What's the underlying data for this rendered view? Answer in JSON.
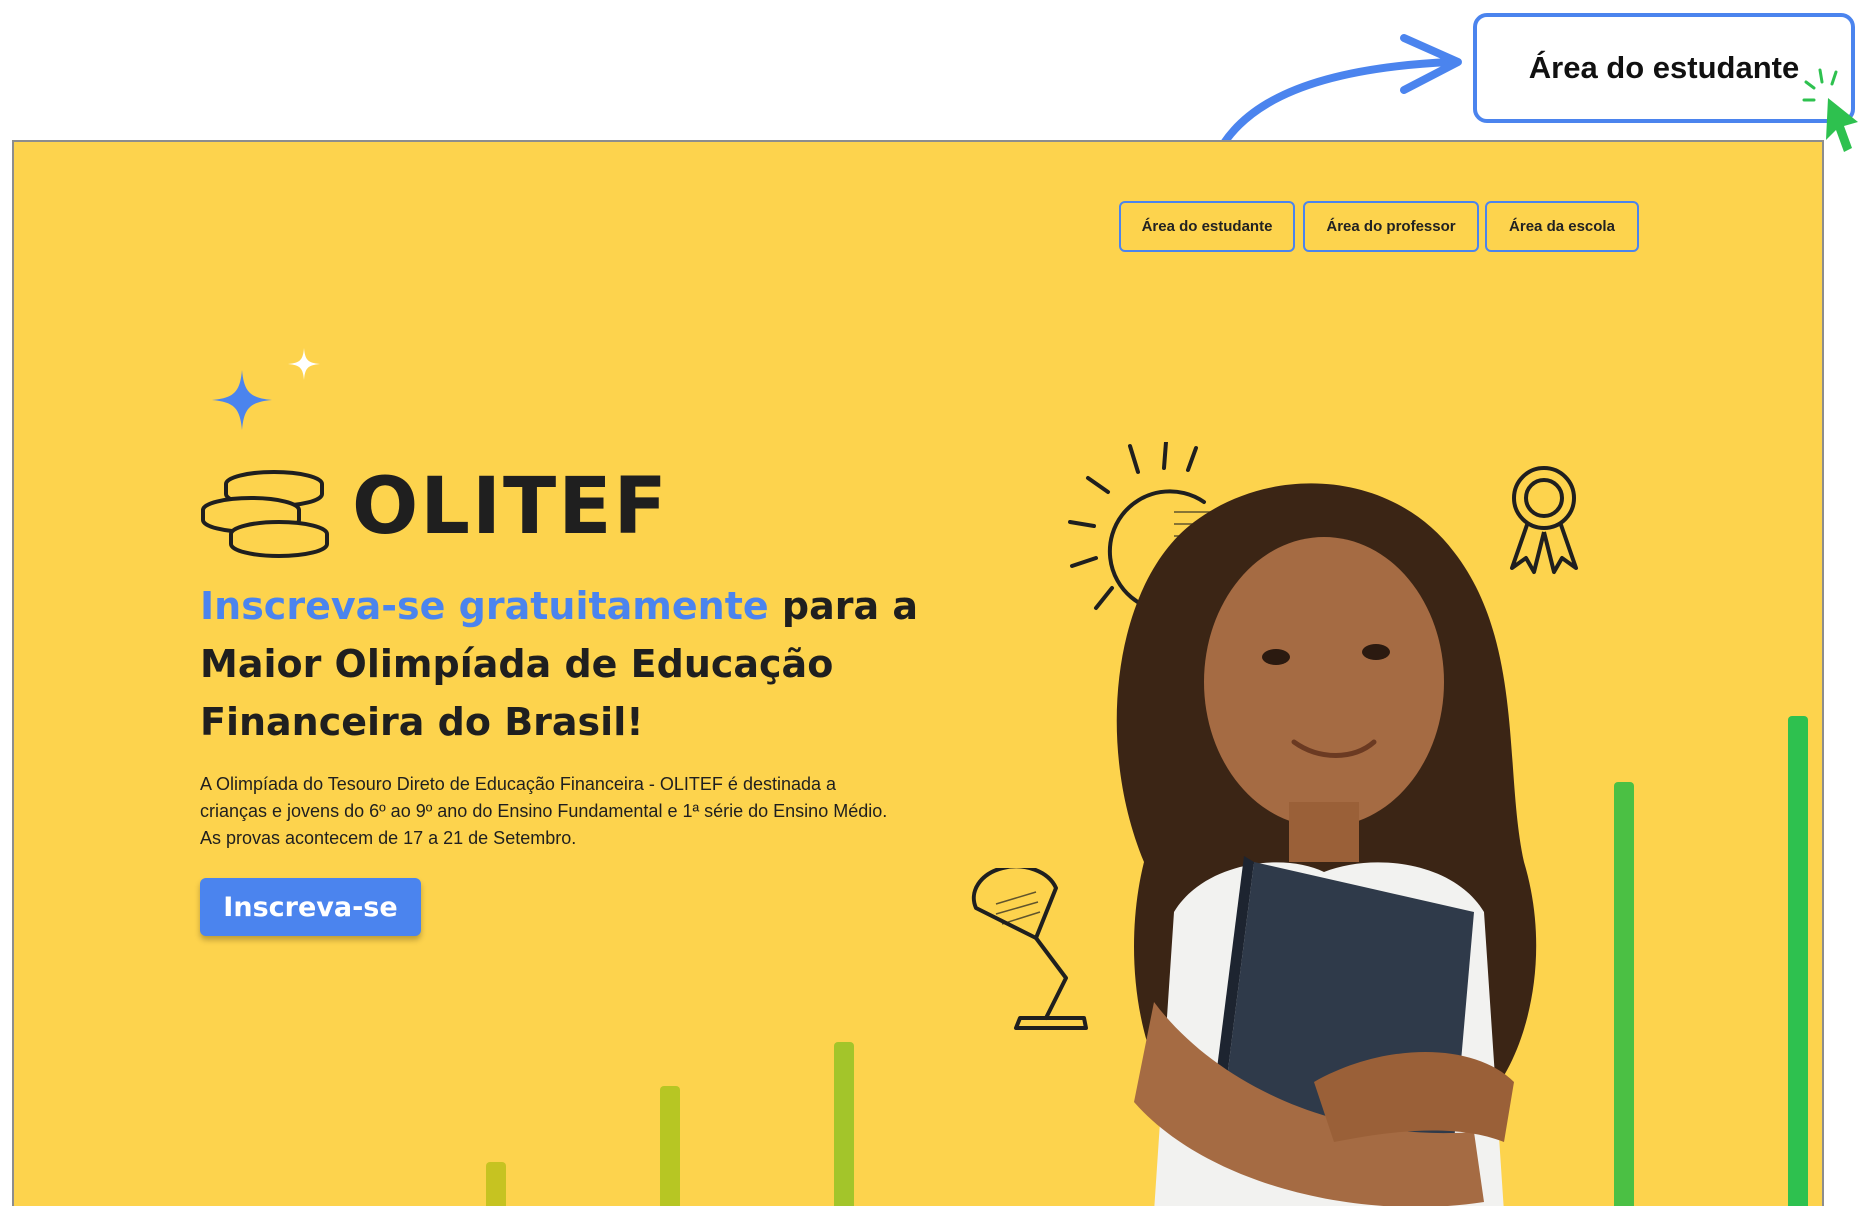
{
  "callout": {
    "label": "Área do estudante"
  },
  "nav": [
    {
      "label": "Área do estudante"
    },
    {
      "label": "Área do professor"
    },
    {
      "label": "Área da escola"
    }
  ],
  "brand": {
    "name": "OLITEF"
  },
  "hero": {
    "headline_highlight": "Inscreva-se gratuitamente",
    "headline_rest_1": " para a",
    "headline_rest_2": "Maior Olimpíada de Educação",
    "headline_rest_3": "Financeira do Brasil!",
    "description": "A Olimpíada do Tesouro Direto de Educação Financeira - OLITEF é destinada a crianças e jovens do 6º ao 9º ano do Ensino Fundamental e 1ª série do Ensino Médio. As provas acontecem de 17 a 21 de Setembro.",
    "cta_label": "Inscreva-se"
  },
  "colors": {
    "background": "#fdd34d",
    "accent_blue": "#4b84ee",
    "text_dark": "#1f1f1f",
    "bar_green": "#2ec14f"
  },
  "icons": [
    "sparkle-icon",
    "coins-icon",
    "sun-icon",
    "medal-icon",
    "lamp-icon",
    "cursor-icon",
    "curved-arrow-icon"
  ]
}
